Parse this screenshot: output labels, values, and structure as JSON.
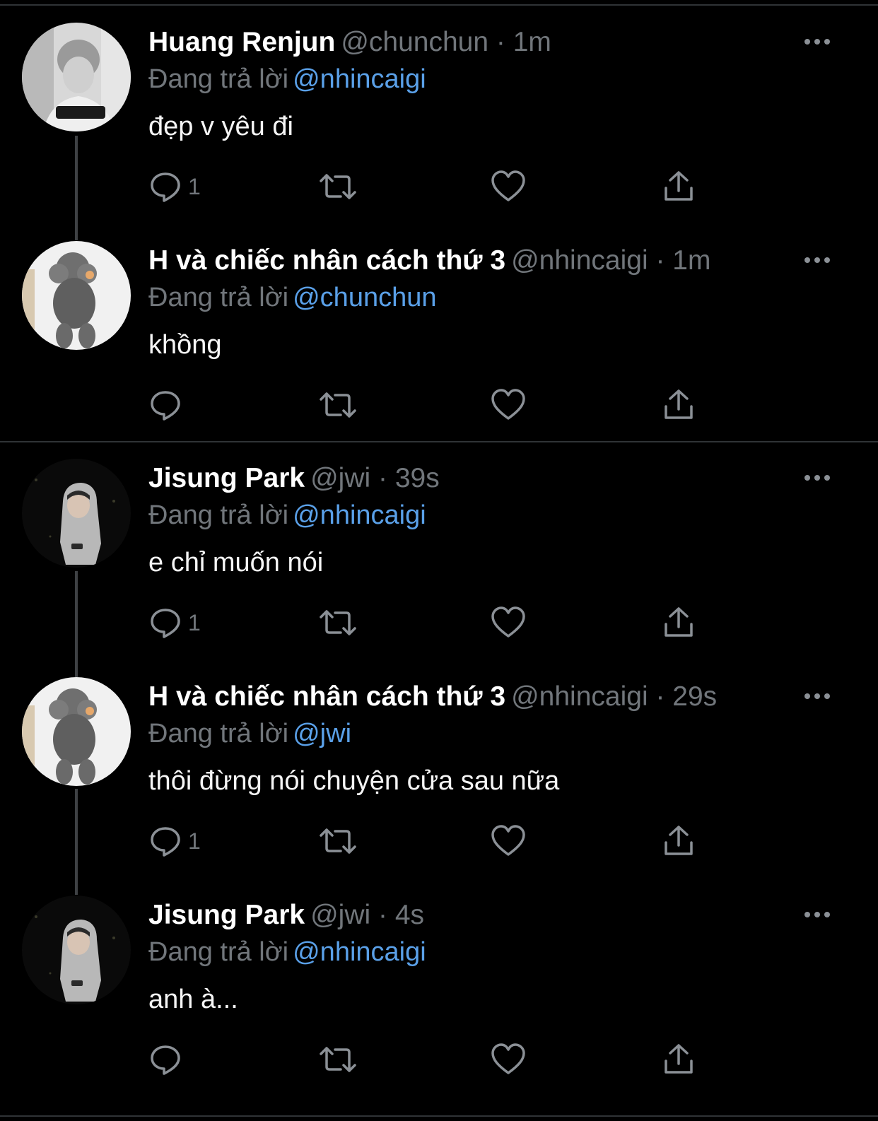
{
  "tweets": [
    {
      "name": "Huang Renjun",
      "handle": "@chunchun",
      "time": "· 1m",
      "reply_prefix": "Đang trả lời",
      "reply_mention": "@nhincaigi",
      "text": "đẹp v yêu đi",
      "reply_count": "1",
      "avatar": "renjun-avatar"
    },
    {
      "name": "H và chiếc nhân cách thứ 3",
      "handle": "@nhincaigi",
      "time": "· 1m",
      "reply_prefix": "Đang trả lời",
      "reply_mention": "@chunchun",
      "text": "khồng",
      "reply_count": "",
      "avatar": "poodle-avatar"
    },
    {
      "name": "Jisung Park",
      "handle": "@jwi",
      "time": "· 39s",
      "reply_prefix": "Đang trả lời",
      "reply_mention": "@nhincaigi",
      "text": "e chỉ muốn nói",
      "reply_count": "1",
      "avatar": "jisung-avatar"
    },
    {
      "name": "H và chiếc nhân cách thứ 3",
      "handle": "@nhincaigi",
      "time": "· 29s",
      "reply_prefix": "Đang trả lời",
      "reply_mention": "@jwi",
      "text": "thôi đừng nói chuyện cửa sau nữa",
      "reply_count": "1",
      "avatar": "poodle-avatar"
    },
    {
      "name": "Jisung Park",
      "handle": "@jwi",
      "time": "· 4s",
      "reply_prefix": "Đang trả lời",
      "reply_mention": "@nhincaigi",
      "text": "anh à...",
      "reply_count": "",
      "avatar": "jisung-avatar"
    }
  ],
  "icons": [
    "reply-icon",
    "retweet-icon",
    "like-icon",
    "share-icon",
    "more-icon"
  ],
  "colors": {
    "background": "#000000",
    "name": "#ffffff",
    "secondary": "#71767b",
    "mention": "#5aa0e8",
    "divider": "#2f3336"
  }
}
